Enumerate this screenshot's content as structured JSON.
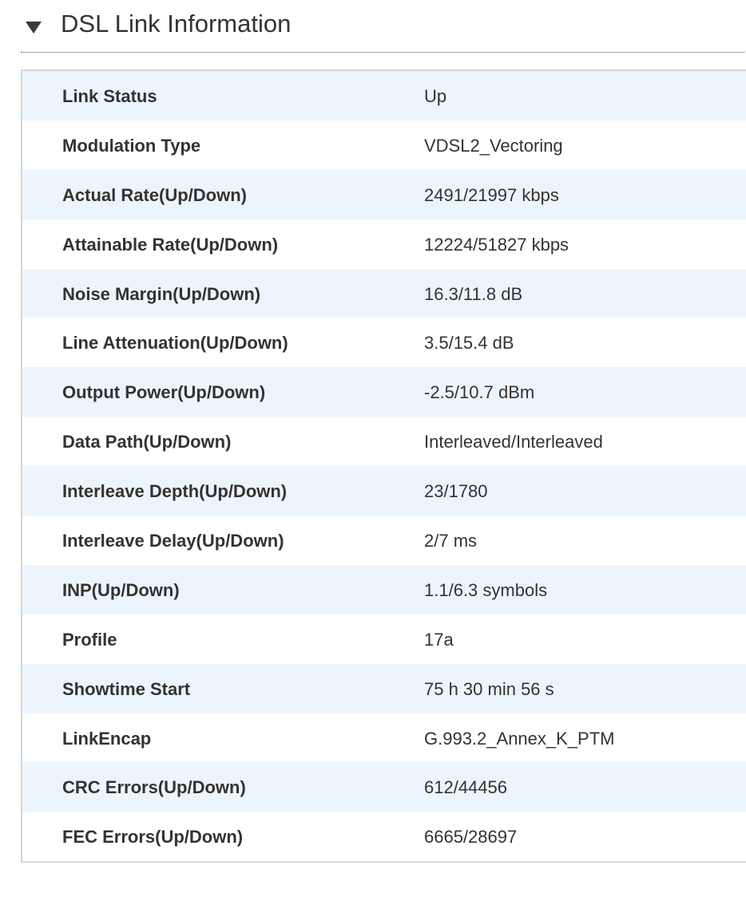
{
  "section": {
    "title": "DSL Link Information"
  },
  "rows": [
    {
      "label": "Link Status",
      "value": "Up"
    },
    {
      "label": "Modulation Type",
      "value": "VDSL2_Vectoring"
    },
    {
      "label": "Actual Rate(Up/Down)",
      "value": "2491/21997 kbps"
    },
    {
      "label": "Attainable Rate(Up/Down)",
      "value": "12224/51827 kbps"
    },
    {
      "label": "Noise Margin(Up/Down)",
      "value": "16.3/11.8 dB"
    },
    {
      "label": "Line Attenuation(Up/Down)",
      "value": "3.5/15.4 dB"
    },
    {
      "label": "Output Power(Up/Down)",
      "value": "-2.5/10.7 dBm"
    },
    {
      "label": "Data Path(Up/Down)",
      "value": "Interleaved/Interleaved"
    },
    {
      "label": "Interleave Depth(Up/Down)",
      "value": "23/1780"
    },
    {
      "label": "Interleave Delay(Up/Down)",
      "value": "2/7 ms"
    },
    {
      "label": "INP(Up/Down)",
      "value": "1.1/6.3 symbols"
    },
    {
      "label": "Profile",
      "value": "17a"
    },
    {
      "label": "Showtime Start",
      "value": "75 h 30 min 56 s"
    },
    {
      "label": "LinkEncap",
      "value": "G.993.2_Annex_K_PTM"
    },
    {
      "label": "CRC Errors(Up/Down)",
      "value": "612/44456"
    },
    {
      "label": "FEC Errors(Up/Down)",
      "value": "6665/28697"
    }
  ],
  "colors": {
    "row_stripe": "#edf5fc",
    "row_plain": "#ffffff",
    "text": "#333333",
    "border": "#d2d6da"
  },
  "icons": {
    "toggle": "collapse-triangle-down-icon"
  }
}
